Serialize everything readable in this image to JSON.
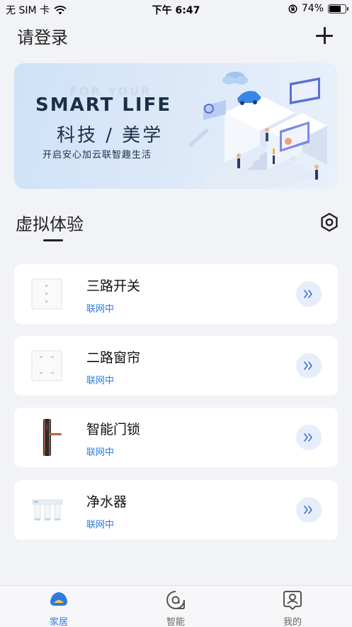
{
  "status_bar": {
    "carrier": "无 SIM 卡",
    "time": "下午 6:47",
    "battery": "74%",
    "battery_level": 0.74
  },
  "header": {
    "title": "请登录",
    "add_icon": "plus-icon"
  },
  "banner": {
    "bg_word": "FOR YOUR",
    "headline": "SMART LIFE",
    "subtitle": "科技 / 美学",
    "tagline": "开启安心加云联智趣生活"
  },
  "section": {
    "title": "虚拟体验",
    "settings_icon": "hexagon-settings-icon"
  },
  "devices": [
    {
      "name": "三路开关",
      "status": "联网中",
      "icon": "three-way-switch-icon"
    },
    {
      "name": "二路窗帘",
      "status": "联网中",
      "icon": "curtain-switch-icon"
    },
    {
      "name": "智能门锁",
      "status": "联网中",
      "icon": "door-lock-icon"
    },
    {
      "name": "净水器",
      "status": "联网中",
      "icon": "water-purifier-icon"
    }
  ],
  "tabs": [
    {
      "label": "家居",
      "icon": "home-icon",
      "active": true
    },
    {
      "label": "智能",
      "icon": "smart-icon",
      "active": false
    },
    {
      "label": "我的",
      "icon": "profile-icon",
      "active": false
    }
  ],
  "colors": {
    "accent": "#2d7ae0",
    "background": "#f2f3f6",
    "card": "#ffffff"
  }
}
